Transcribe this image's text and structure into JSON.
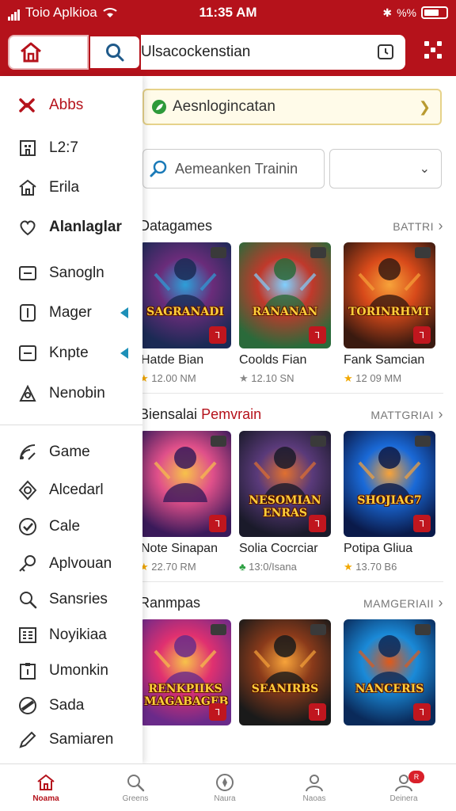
{
  "status_bar": {
    "carrier": "Toio Aplkioa",
    "time": "11:35 AM",
    "right_text": "%%"
  },
  "app_bar": {
    "search_text": "Ulsacockenstian"
  },
  "drawer": {
    "items": [
      {
        "label": "Abbs",
        "icon": "logo-icon",
        "active": true
      },
      {
        "label": "L2:7",
        "icon": "building-icon"
      },
      {
        "label": "Erila",
        "icon": "home-icon"
      },
      {
        "label": "Alanlaglar",
        "icon": "heart-icon",
        "bold": true
      },
      {
        "label": "Sanogln",
        "icon": "message-icon"
      },
      {
        "label": "Mager",
        "icon": "tablet-icon",
        "arrow": true
      },
      {
        "label": "Knpte",
        "icon": "minus-box-icon",
        "arrow": true
      },
      {
        "label": "Nenobin",
        "icon": "people-icon"
      },
      {
        "label": "Game",
        "icon": "rss-icon"
      },
      {
        "label": "Alcedarl",
        "icon": "badge-icon"
      },
      {
        "label": "Cale",
        "icon": "check-circle-icon"
      },
      {
        "label": "Aplvouan",
        "icon": "key-icon"
      },
      {
        "label": "Sansries",
        "icon": "search-icon"
      },
      {
        "label": "Noyikiaa",
        "icon": "grid-box-icon"
      },
      {
        "label": "Umonkin",
        "icon": "clipboard-icon"
      },
      {
        "label": "Sada",
        "icon": "pie-icon"
      },
      {
        "label": "Samiaren",
        "icon": "pen-icon"
      }
    ]
  },
  "promo": {
    "text": "Aesnlogincatan"
  },
  "filter": {
    "placeholder": "Aemeanken Trainin",
    "select_value": ""
  },
  "sections": [
    {
      "title": "Datagames",
      "title_accent": "",
      "more": "BATTRI",
      "cards": [
        {
          "logo": "SAGRANADI",
          "title": "Hatde Bian",
          "meta": "12.00 NM",
          "rating_icon": "star",
          "palette": [
            "#1b2a55",
            "#6a2c7a",
            "#2d9fd8"
          ]
        },
        {
          "logo": "RANANAN",
          "title": "Coolds Fian",
          "meta": "12.10 SN",
          "rating_icon": "star-grey",
          "palette": [
            "#2a6a3a",
            "#c0392b",
            "#7fd0ff"
          ]
        },
        {
          "logo": "TORINRHMT",
          "title": "Fank Samcian",
          "meta": "12 09 MM",
          "rating_icon": "star",
          "palette": [
            "#3a1a10",
            "#d84a1a",
            "#f7a33a"
          ]
        }
      ]
    },
    {
      "title": "Biensalai",
      "title_accent": "Pemvrain",
      "more": "MATTGRIAI",
      "cards": [
        {
          "logo": "",
          "title": "Note Sinapan",
          "meta": "22.70 RM",
          "rating_icon": "star",
          "palette": [
            "#3a1a5a",
            "#e0508a",
            "#f7c24a"
          ]
        },
        {
          "logo": "NESOMIAN ENRAS",
          "title": "Solia Cocrciar",
          "meta": "13:0/Isana",
          "rating_icon": "leaf",
          "palette": [
            "#1a1a2a",
            "#5a3a7a",
            "#e07030"
          ]
        },
        {
          "logo": "SHOJIAG7",
          "title": "Potipa Gliua",
          "meta": "13.70 B6",
          "rating_icon": "star",
          "palette": [
            "#0a1a4a",
            "#1a6ad8",
            "#f7a33a"
          ]
        }
      ]
    },
    {
      "title": "Ranmpas",
      "title_accent": "",
      "more": "MAMGERIAII",
      "cards": [
        {
          "logo": "RENKPIIKS MAGABAGEB",
          "title": "",
          "meta": "",
          "rating_icon": "",
          "palette": [
            "#6a2a8a",
            "#e03070",
            "#f7c24a"
          ]
        },
        {
          "logo": "SEANIRBS",
          "title": "",
          "meta": "",
          "rating_icon": "",
          "palette": [
            "#1a1a1a",
            "#8a3a1a",
            "#f7a33a"
          ]
        },
        {
          "logo": "NANCERIS",
          "title": "",
          "meta": "",
          "rating_icon": "",
          "palette": [
            "#0a2a5a",
            "#1a8ad8",
            "#e05a1a"
          ]
        }
      ]
    }
  ],
  "bottom_nav": [
    {
      "label": "Noama",
      "icon": "home-icon",
      "active": true
    },
    {
      "label": "Greens",
      "icon": "search-icon"
    },
    {
      "label": "Naura",
      "icon": "compass-icon"
    },
    {
      "label": "Naoas",
      "icon": "person-icon"
    },
    {
      "label": "Deinera",
      "icon": "person-badge-icon",
      "badge": "R"
    }
  ]
}
